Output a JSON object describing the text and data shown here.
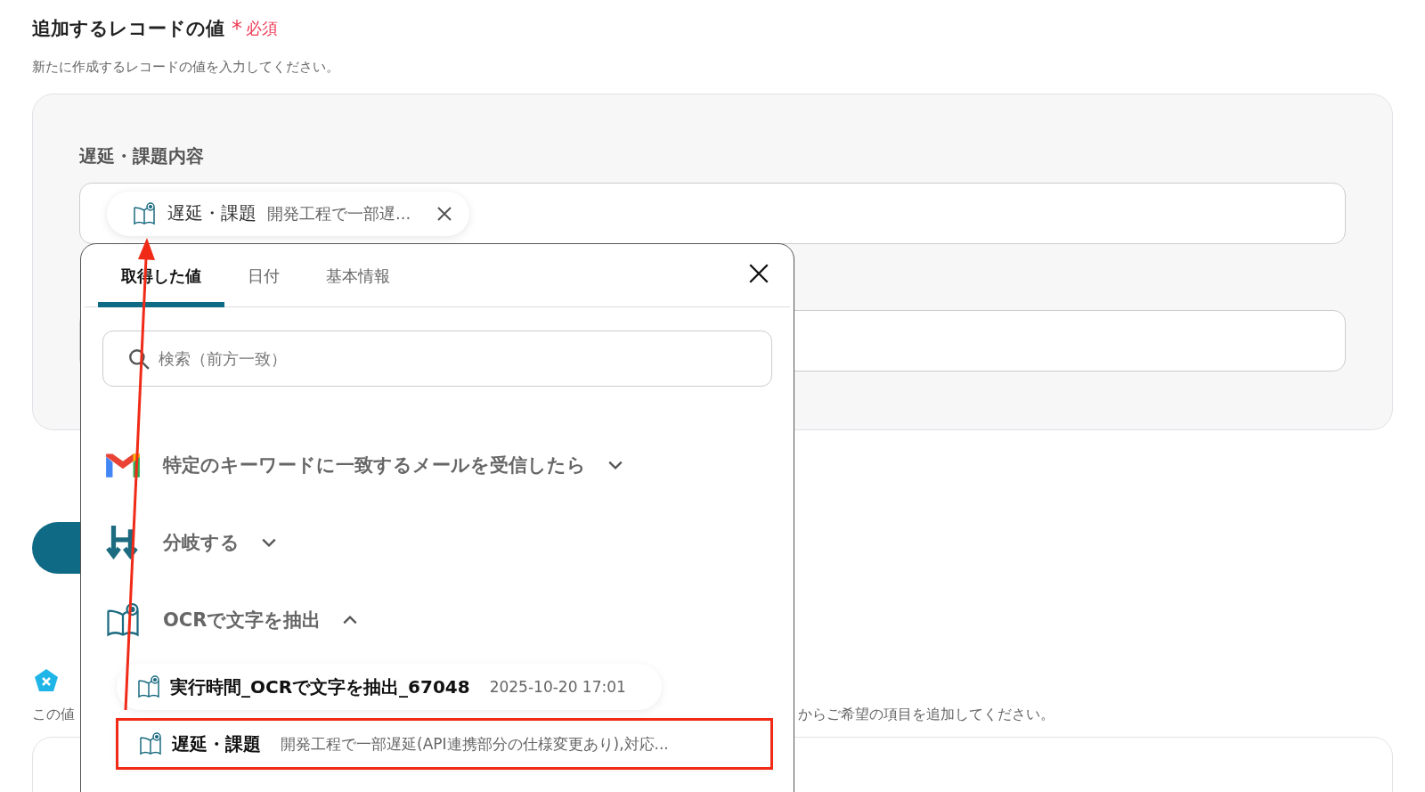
{
  "section": {
    "title": "追加するレコードの値",
    "required_mark": "*",
    "required_label": "必須",
    "description": "新たに作成するレコードの値を入力してください。"
  },
  "fields": [
    {
      "label": "遅延・課題内容",
      "token": {
        "name": "遅延・課題",
        "preview": "開発工程で一部遅..."
      }
    }
  ],
  "next_section": {
    "description_start": "この値",
    "description_end": "からご希望の項目を追加してください。"
  },
  "picker": {
    "tabs": [
      {
        "label": "取得した値",
        "selected": true
      },
      {
        "label": "日付",
        "selected": false
      },
      {
        "label": "基本情報",
        "selected": false
      }
    ],
    "search": {
      "placeholder": "検索（前方一致）"
    },
    "groups": [
      {
        "kind": "gmail",
        "title": "特定のキーワードに一致するメールを受信したら",
        "expanded": false
      },
      {
        "kind": "branch",
        "title": "分岐する",
        "expanded": false
      },
      {
        "kind": "ocr",
        "title": "OCRで文字を抽出",
        "expanded": true,
        "items": [
          {
            "name": "実行時間_OCRで文字を抽出_67048",
            "value": "2025-10-20 17:01",
            "highlighted": false
          },
          {
            "name": "遅延・課題",
            "value": "開発工程で一部遅延(API連携部分の仕様変更あり),対応...",
            "highlighted": true
          }
        ]
      }
    ]
  }
}
